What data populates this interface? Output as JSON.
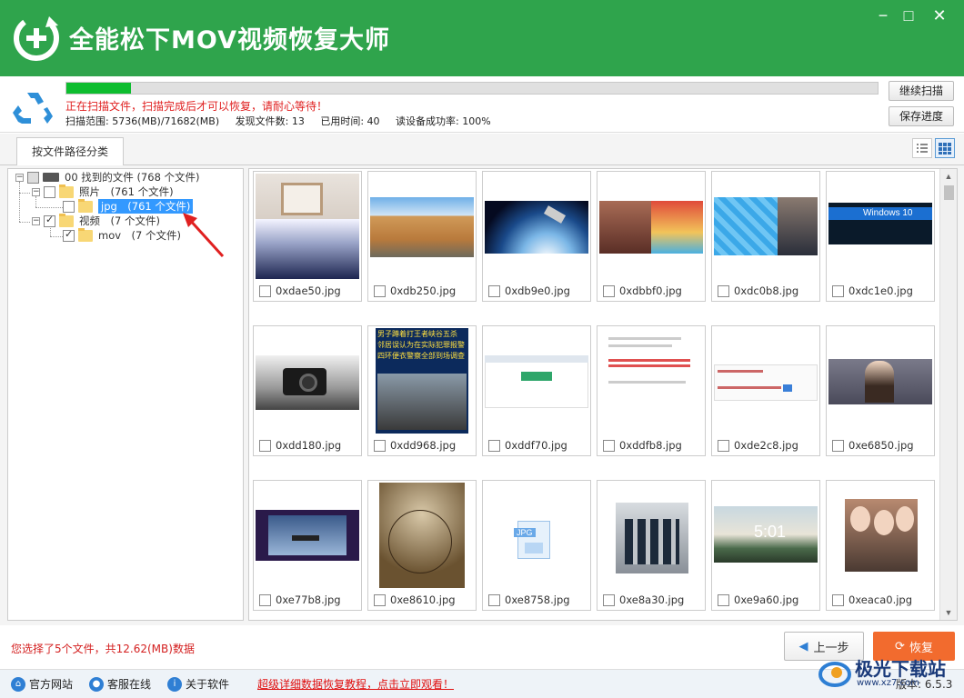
{
  "app": {
    "title": "全能松下MOV视频恢复大师"
  },
  "window_controls": {
    "minimize": "−",
    "maximize": "□",
    "close": "✕"
  },
  "scan": {
    "progress_pct": 8,
    "message": "正在扫描文件，扫描完成后才可以恢复，请耐心等待！",
    "range": "扫描范围: 5736(MB)/71682(MB)",
    "found": "发现文件数: 13",
    "elapsed": "已用时间: 40",
    "success_rate": "读设备成功率: 100%",
    "continue_label": "继续扫描",
    "save_label": "保存进度"
  },
  "tab": {
    "label": "按文件路径分类"
  },
  "tree": {
    "root": "00 找到的文件 (768 个文件)",
    "photos": "照片　(761 个文件)",
    "jpg": "jpg　(761 个文件)",
    "videos": "视频　(7 个文件)",
    "mov": "mov　(7 个文件)"
  },
  "thumbs": [
    {
      "name": "0xdae50.jpg"
    },
    {
      "name": "0xdb250.jpg"
    },
    {
      "name": "0xdb9e0.jpg"
    },
    {
      "name": "0xdbbf0.jpg"
    },
    {
      "name": "0xdc0b8.jpg"
    },
    {
      "name": "0xdc1e0.jpg"
    },
    {
      "name": "0xdd180.jpg"
    },
    {
      "name": "0xdd968.jpg"
    },
    {
      "name": "0xddf70.jpg"
    },
    {
      "name": "0xddfb8.jpg"
    },
    {
      "name": "0xde2c8.jpg"
    },
    {
      "name": "0xe6850.jpg"
    },
    {
      "name": "0xe77b8.jpg"
    },
    {
      "name": "0xe8610.jpg"
    },
    {
      "name": "0xe8758.jpg"
    },
    {
      "name": "0xe8a30.jpg"
    },
    {
      "name": "0xe9a60.jpg"
    },
    {
      "name": "0xeaca0.jpg"
    }
  ],
  "thumb_texts": {
    "win10": "Windows 10",
    "jpg_badge": "JPG",
    "clock": "5:01",
    "video_caption_1": "男子蹲着打王者峡谷五杀",
    "video_caption_2": "邻居误认为在实际犯罪报警",
    "video_caption_3": "四环便衣警察全部到场调查"
  },
  "bottom": {
    "selection": "您选择了5个文件，共12.62(MB)数据",
    "prev_label": "上一步",
    "recover_label": "恢复"
  },
  "status": {
    "website": "官方网站",
    "support": "客服在线",
    "about": "关于软件",
    "tutorial": "超级详细数据恢复教程，点击立即观看！",
    "version": "版本: 6.5.3"
  },
  "watermark": {
    "title": "极光下载站",
    "url": "www.xz7.com"
  },
  "colors": {
    "title_green": "#2fa44c",
    "progress_green": "#0dbd2f",
    "recover_orange": "#f26b2e",
    "warning_red": "#e02020"
  }
}
